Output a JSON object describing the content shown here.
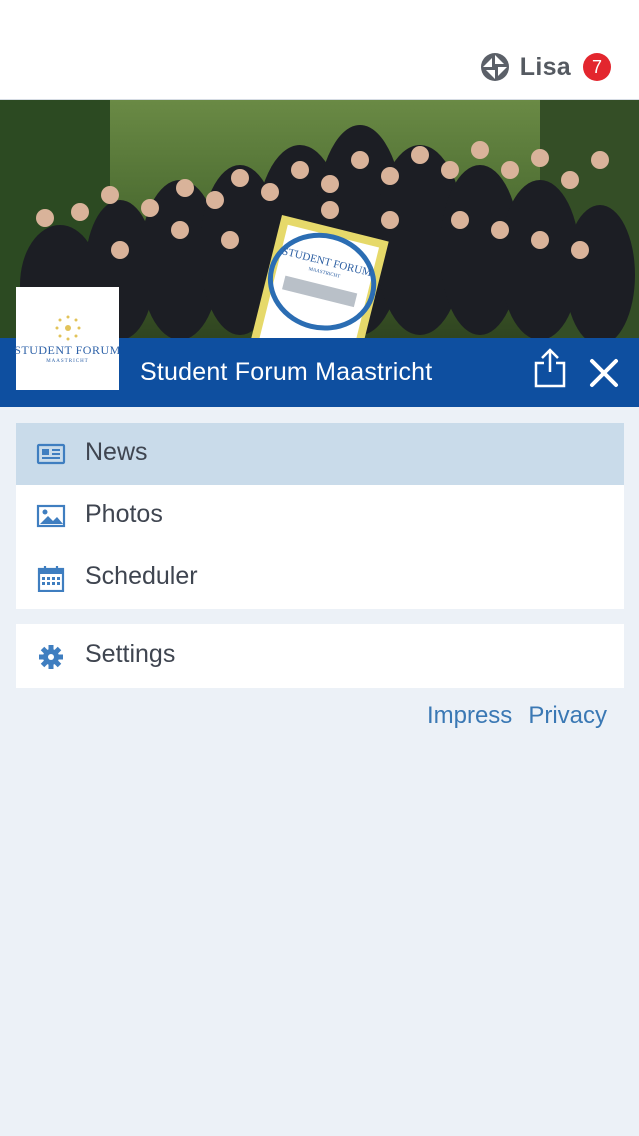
{
  "header": {
    "user_name": "Lisa",
    "notification_count": "7"
  },
  "club": {
    "name": "Student Forum Maastricht",
    "logo_line1": "STUDENT FORUM",
    "logo_line2": "MAASTRICHT"
  },
  "banner": {
    "line1": "STUDENT FORUM",
    "line2": "MAASTRICHT"
  },
  "menu": {
    "items": [
      {
        "label": "News",
        "icon": "newspaper-icon",
        "active": true
      },
      {
        "label": "Photos",
        "icon": "image-icon",
        "active": false
      },
      {
        "label": "Scheduler",
        "icon": "calendar-icon",
        "active": false
      }
    ],
    "settings_label": "Settings"
  },
  "footer_links": {
    "impress": "Impress",
    "privacy": "Privacy"
  },
  "colors": {
    "club_bar": "#0e4fa0",
    "active_item": "#c9dbea",
    "link": "#3a78b4",
    "badge": "#e3262e",
    "background": "#ecf1f7"
  }
}
